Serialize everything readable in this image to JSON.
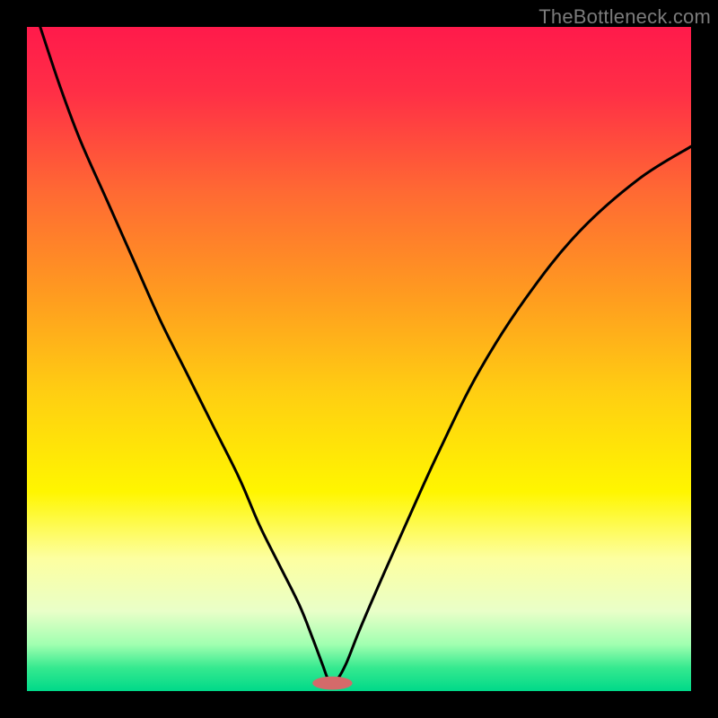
{
  "watermark": "TheBottleneck.com",
  "chart_data": {
    "type": "line",
    "title": "",
    "xlabel": "",
    "ylabel": "",
    "xlim": [
      0,
      100
    ],
    "ylim": [
      0,
      100
    ],
    "background_gradient": {
      "stops": [
        {
          "pos": 0.0,
          "color": "#ff1a4b"
        },
        {
          "pos": 0.1,
          "color": "#ff2f46"
        },
        {
          "pos": 0.25,
          "color": "#ff6a33"
        },
        {
          "pos": 0.4,
          "color": "#ff9a20"
        },
        {
          "pos": 0.55,
          "color": "#ffce12"
        },
        {
          "pos": 0.7,
          "color": "#fff600"
        },
        {
          "pos": 0.8,
          "color": "#fdffa0"
        },
        {
          "pos": 0.88,
          "color": "#e9ffc8"
        },
        {
          "pos": 0.93,
          "color": "#a0ffb0"
        },
        {
          "pos": 0.965,
          "color": "#35e98f"
        },
        {
          "pos": 1.0,
          "color": "#00d989"
        }
      ]
    },
    "series": [
      {
        "name": "bottleneck-curve",
        "color": "#000000",
        "stroke_width": 3,
        "x": [
          2,
          5,
          8,
          12,
          16,
          20,
          24,
          28,
          32,
          35,
          38,
          41,
          43,
          44.5,
          45.5,
          46.5,
          48,
          50,
          53,
          57,
          62,
          68,
          75,
          83,
          92,
          100
        ],
        "y": [
          100,
          91,
          83,
          74,
          65,
          56,
          48,
          40,
          32,
          25,
          19,
          13,
          8,
          4,
          1.5,
          1.5,
          4,
          9,
          16,
          25,
          36,
          48,
          59,
          69,
          77,
          82
        ]
      }
    ],
    "marker": {
      "name": "optimal-point",
      "x": 46,
      "y": 1.2,
      "rx": 3.0,
      "ry": 1.0,
      "fill": "#d46a6a"
    }
  }
}
